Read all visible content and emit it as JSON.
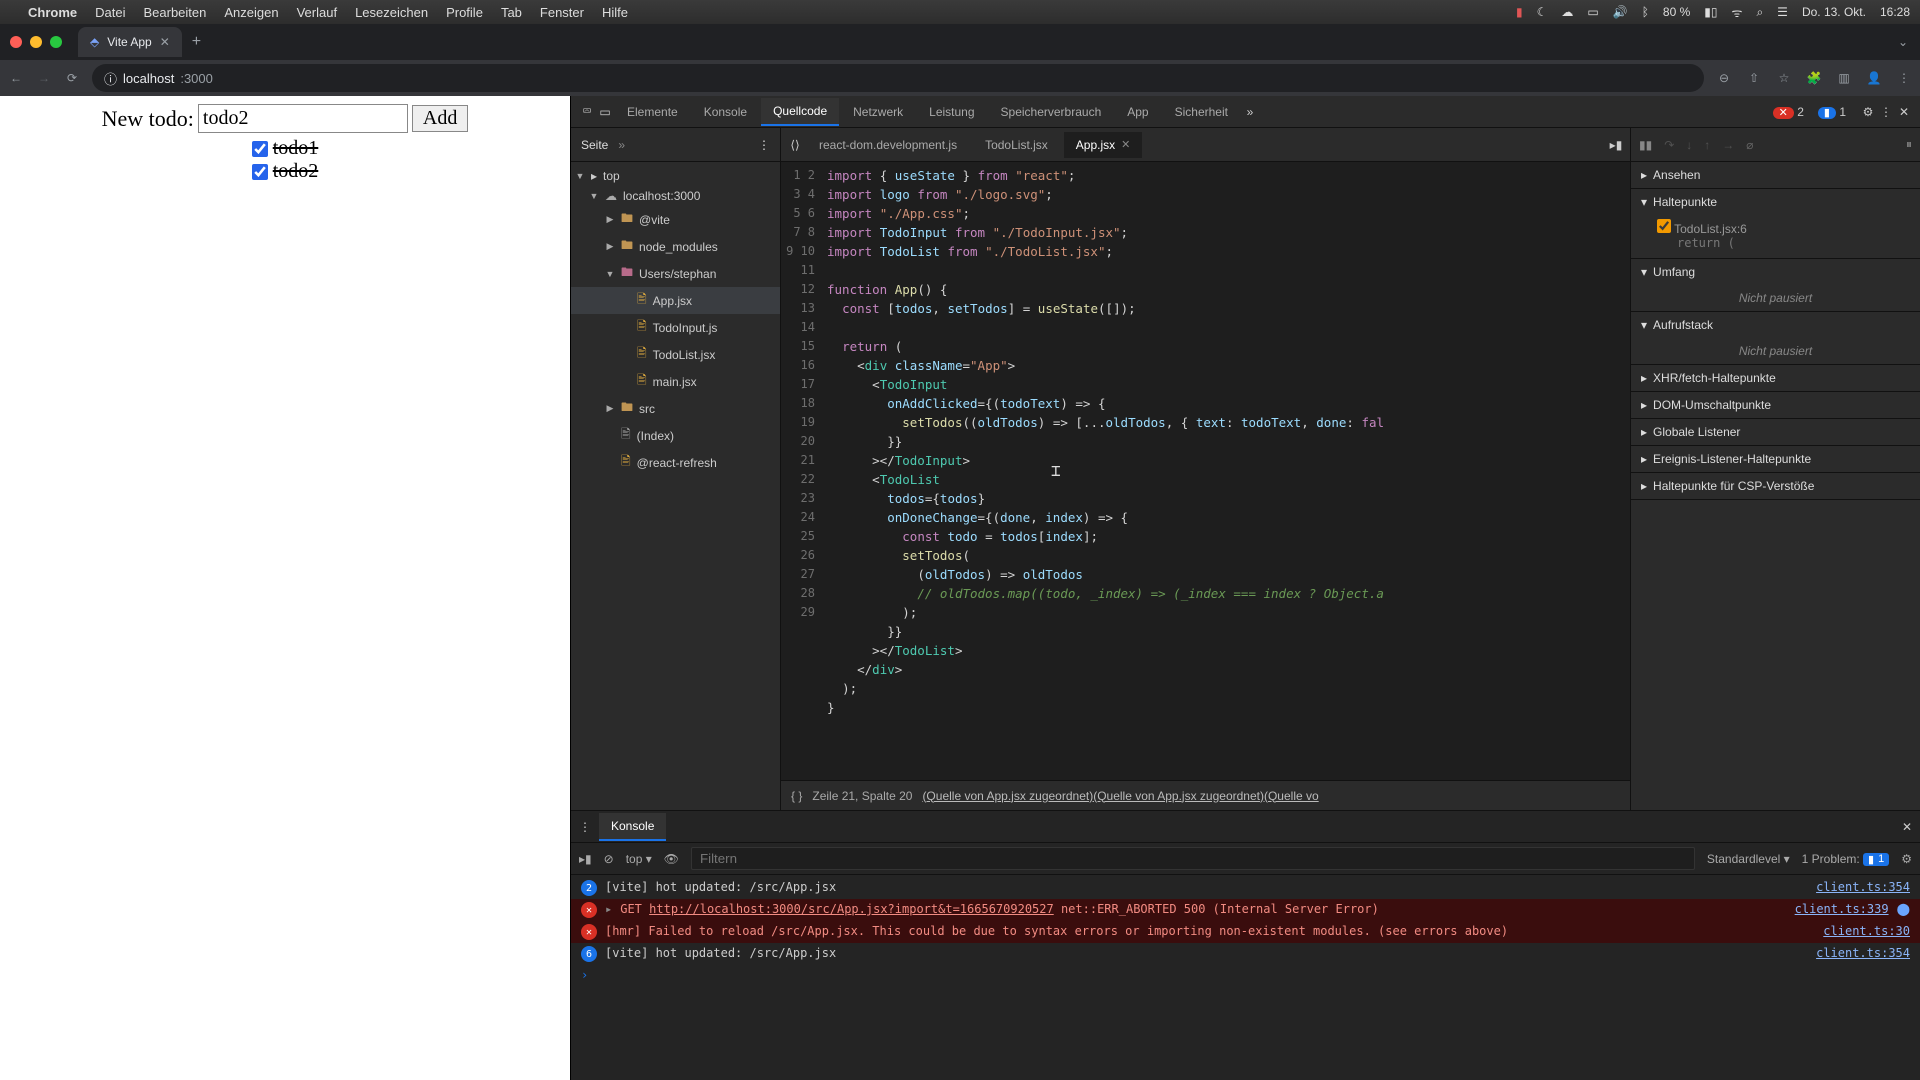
{
  "macos": {
    "app": "Chrome",
    "menus": [
      "Datei",
      "Bearbeiten",
      "Anzeigen",
      "Verlauf",
      "Lesezeichen",
      "Profile",
      "Tab",
      "Fenster",
      "Hilfe"
    ],
    "right": {
      "battery": "80 %",
      "date": "Do. 13. Okt.",
      "time": "16:28"
    }
  },
  "browser": {
    "tab_title": "Vite App",
    "url_host": "localhost",
    "url_port": ":3000"
  },
  "page": {
    "new_todo_label": "New todo:",
    "new_todo_value": "todo2",
    "add_button": "Add",
    "todos": [
      {
        "text": "todo1",
        "done": true
      },
      {
        "text": "todo2",
        "done": true
      }
    ]
  },
  "devtools": {
    "tabs": [
      "Elemente",
      "Konsole",
      "Quellcode",
      "Netzwerk",
      "Leistung",
      "Speicherverbrauch",
      "App",
      "Sicherheit"
    ],
    "active_tab": "Quellcode",
    "error_count": "2",
    "info_count": "1",
    "sources": {
      "page_label": "Seite",
      "tree": {
        "top": "top",
        "host": "localhost:3000",
        "folders": [
          {
            "name": "@vite",
            "indent": 3
          },
          {
            "name": "node_modules",
            "indent": 3
          },
          {
            "name": "Users/stephan",
            "indent": 3,
            "expanded": true,
            "pink": true,
            "files": [
              "App.jsx",
              "TodoInput.js",
              "TodoList.jsx",
              "main.jsx"
            ]
          },
          {
            "name": "src",
            "indent": 3
          }
        ],
        "extra_files": [
          "(Index)",
          "@react-refresh"
        ]
      }
    },
    "editor": {
      "tabs": [
        "react-dom.development.js",
        "TodoList.jsx",
        "App.jsx"
      ],
      "active": "App.jsx",
      "lines": [
        "import { useState } from \"react\";",
        "import logo from \"./logo.svg\";",
        "import \"./App.css\";",
        "import TodoInput from \"./TodoInput.jsx\";",
        "import TodoList from \"./TodoList.jsx\";",
        "",
        "function App() {",
        "  const [todos, setTodos] = useState([]);",
        "",
        "  return (",
        "    <div className=\"App\">",
        "      <TodoInput",
        "        onAddClicked={(todoText) => {",
        "          setTodos((oldTodos) => [...oldTodos, { text: todoText, done: fal",
        "        }}",
        "      ></TodoInput>",
        "      <TodoList",
        "        todos={todos}",
        "        onDoneChange={(done, index) => {",
        "          const todo = todos[index];",
        "          setTodos(",
        "            (oldTodos) => oldTodos",
        "            // oldTodos.map((todo, _index) => (_index === index ? Object.a",
        "          );",
        "        }}",
        "      ></TodoList>",
        "    </div>",
        "  );",
        "}"
      ],
      "status": {
        "pos": "Zeile 21, Spalte 20",
        "mapped": "(Quelle von App.jsx zugeordnet)(Quelle von App.jsx zugeordnet)(Quelle vo"
      }
    },
    "debugger": {
      "watch": "Ansehen",
      "breakpoints": "Haltepunkte",
      "bp_file": "TodoList.jsx:6",
      "bp_code": "return (",
      "scope": "Umfang",
      "not_paused": "Nicht pausiert",
      "callstack": "Aufrufstack",
      "xhr_bp": "XHR/fetch-Haltepunkte",
      "dom_bp": "DOM-Umschaltpunkte",
      "global_listeners": "Globale Listener",
      "event_bp": "Ereignis-Listener-Haltepunkte",
      "csp_bp": "Haltepunkte für CSP-Verstöße"
    },
    "console": {
      "drawer_tab": "Konsole",
      "context": "top",
      "filter_placeholder": "Filtern",
      "level": "Standardlevel",
      "problems_label": "1 Problem:",
      "problems_count": "1",
      "logs": [
        {
          "type": "info",
          "badge": "2",
          "msg": "[vite] hot updated: /src/App.jsx",
          "src": "client.ts:354"
        },
        {
          "type": "err",
          "badge": "x",
          "msg": "GET http://localhost:3000/src/App.jsx?import&t=1665670920527 net::ERR_ABORTED 500 (Internal Server Error)",
          "src": "client.ts:339"
        },
        {
          "type": "err",
          "badge": "x",
          "msg": "[hmr] Failed to reload /src/App.jsx. This could be due to syntax errors or importing non-existent modules. (see errors above)",
          "src": "client.ts:30"
        },
        {
          "type": "info",
          "badge": "6",
          "msg": "[vite] hot updated: /src/App.jsx",
          "src": "client.ts:354"
        }
      ]
    }
  }
}
